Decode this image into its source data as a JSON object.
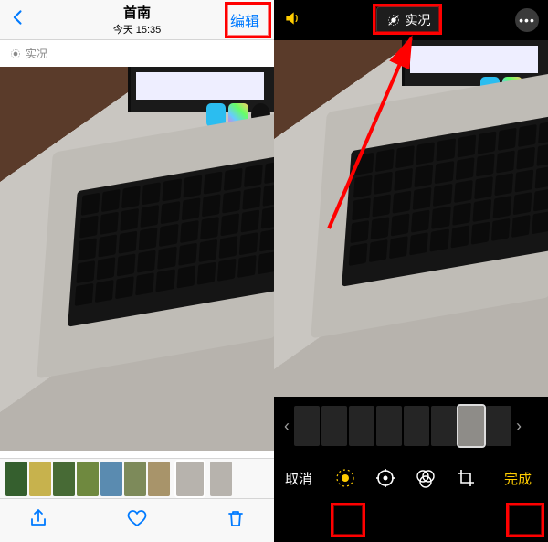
{
  "left": {
    "title": "首南",
    "subtitle": "今天 15:35",
    "edit_label": "编辑",
    "live_label": "实况",
    "thumbs_count": 9
  },
  "right": {
    "live_label": "实况",
    "cancel_label": "取消",
    "done_label": "完成",
    "frames_count": 8
  },
  "colors": {
    "ios_blue": "#007aff",
    "ios_yellow": "#ffcc00",
    "highlight": "#ff0000"
  },
  "icons": {
    "back": "chevron-left-icon",
    "live": "live-photo-icon",
    "share": "share-icon",
    "heart": "heart-icon",
    "trash": "trash-icon",
    "speaker": "speaker-icon",
    "live_off": "live-photo-off-icon",
    "more": "more-icon",
    "tool_live": "live-tool-icon",
    "tool_adjust": "adjust-icon",
    "tool_filters": "filters-icon",
    "tool_crop": "crop-icon"
  }
}
